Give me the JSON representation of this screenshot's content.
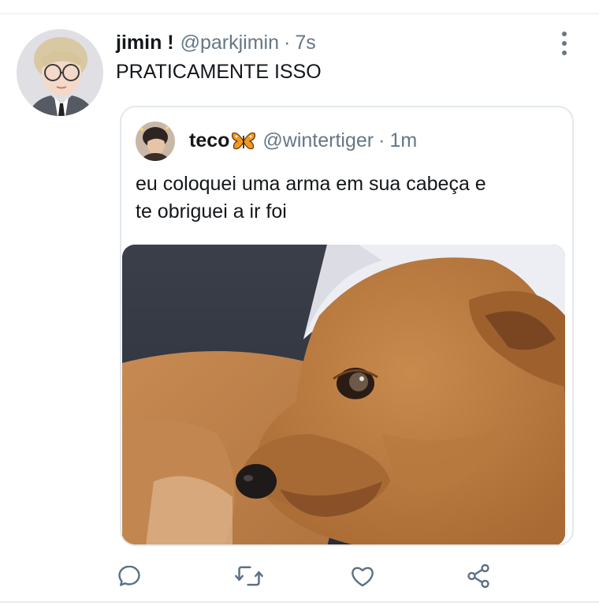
{
  "tweet": {
    "display_name": "jimin !",
    "handle": "@parkjimin",
    "separator": "·",
    "time": "7s",
    "text": "PRATICAMENTE ISSO"
  },
  "quoted_tweet": {
    "display_name": "teco",
    "name_emoji_icon": "butterfly-icon",
    "handle": "@wintertiger",
    "separator": "·",
    "time": "1m",
    "text_line1": "eu coloquei uma arma em sua cabeça e",
    "text_line2": "te obriguei a ir foi",
    "image_subject": "dog"
  },
  "actions": [
    {
      "icon": "reply-icon"
    },
    {
      "icon": "retweet-icon"
    },
    {
      "icon": "like-icon"
    },
    {
      "icon": "share-icon"
    }
  ],
  "colors": {
    "text_primary": "#14171a",
    "text_secondary": "#657786",
    "border": "#e1e8ed",
    "action_icon": "#5b7083"
  }
}
